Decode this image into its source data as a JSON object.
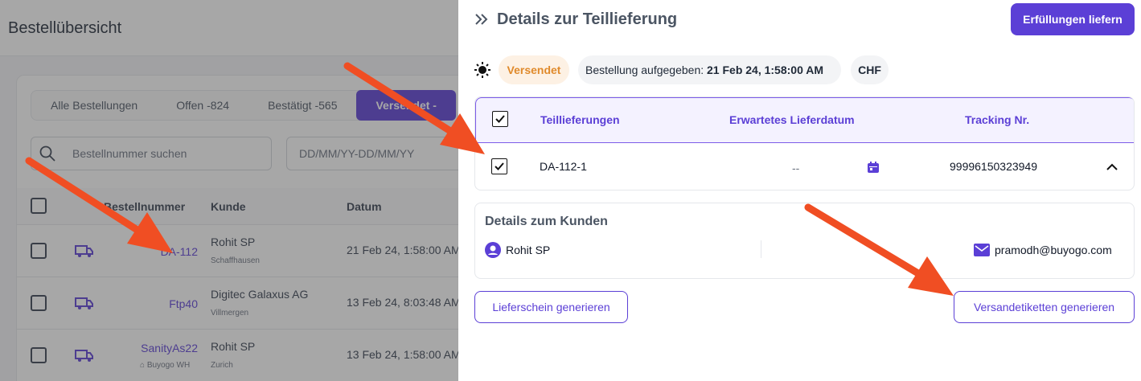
{
  "background": {
    "title": "Bestellübersicht",
    "tabs": [
      {
        "label": "Alle Bestellungen"
      },
      {
        "label": "Offen -824"
      },
      {
        "label": "Bestätigt -565"
      },
      {
        "label": "Versendet -"
      }
    ],
    "search_placeholder": "Bestellnummer suchen",
    "date_placeholder": "DD/MM/YY-DD/MM/YY",
    "columns": {
      "order": "Bestellnummer",
      "customer": "Kunde",
      "date": "Datum"
    },
    "rows": [
      {
        "order": "DA-112",
        "warehouse": "",
        "customer": "Rohit SP",
        "city": "Schaffhausen",
        "date": "21 Feb 24, 1:58:00 AM"
      },
      {
        "order": "Ftp40",
        "warehouse": "",
        "customer": "Digitec Galaxus AG",
        "city": "Villmergen",
        "date": "13 Feb 24, 8:03:48 AM"
      },
      {
        "order": "SanityAs22",
        "warehouse": "Buyogo WH",
        "customer": "Rohit SP",
        "city": "Zurich",
        "date": "13 Feb 24, 1:58:00 AM"
      }
    ]
  },
  "panel": {
    "title": "Details zur Teillieferung",
    "fulfill_button": "Erfüllungen liefern",
    "status": "Versendet",
    "ordered_label": "Bestellung aufgegeben:",
    "ordered_value": "21 Feb 24, 1:58:00 AM",
    "currency": "CHF",
    "table": {
      "headers": {
        "partial": "Teillieferungen",
        "expected": "Erwartetes Lieferdatum",
        "tracking": "Tracking Nr."
      },
      "row": {
        "id": "DA-112-1",
        "expected": "--",
        "tracking": "99996150323949",
        "checked": true
      },
      "all_checked": true
    },
    "customer": {
      "title": "Details zum Kunden",
      "name": "Rohit SP",
      "email": "pramodh@buyogo.com"
    },
    "delivery_note_button": "Lieferschein generieren",
    "shipping_label_button": "Versandetiketten generieren"
  },
  "colors": {
    "accent": "#5b3fd6",
    "status": "#e08a2b",
    "annotation": "#f04e23"
  },
  "icons": [
    "double-chevron-right-icon",
    "sun-icon",
    "calendar-icon",
    "chevron-up-icon",
    "user-icon",
    "mail-icon",
    "search-icon",
    "truck-icon",
    "warehouse-icon"
  ]
}
